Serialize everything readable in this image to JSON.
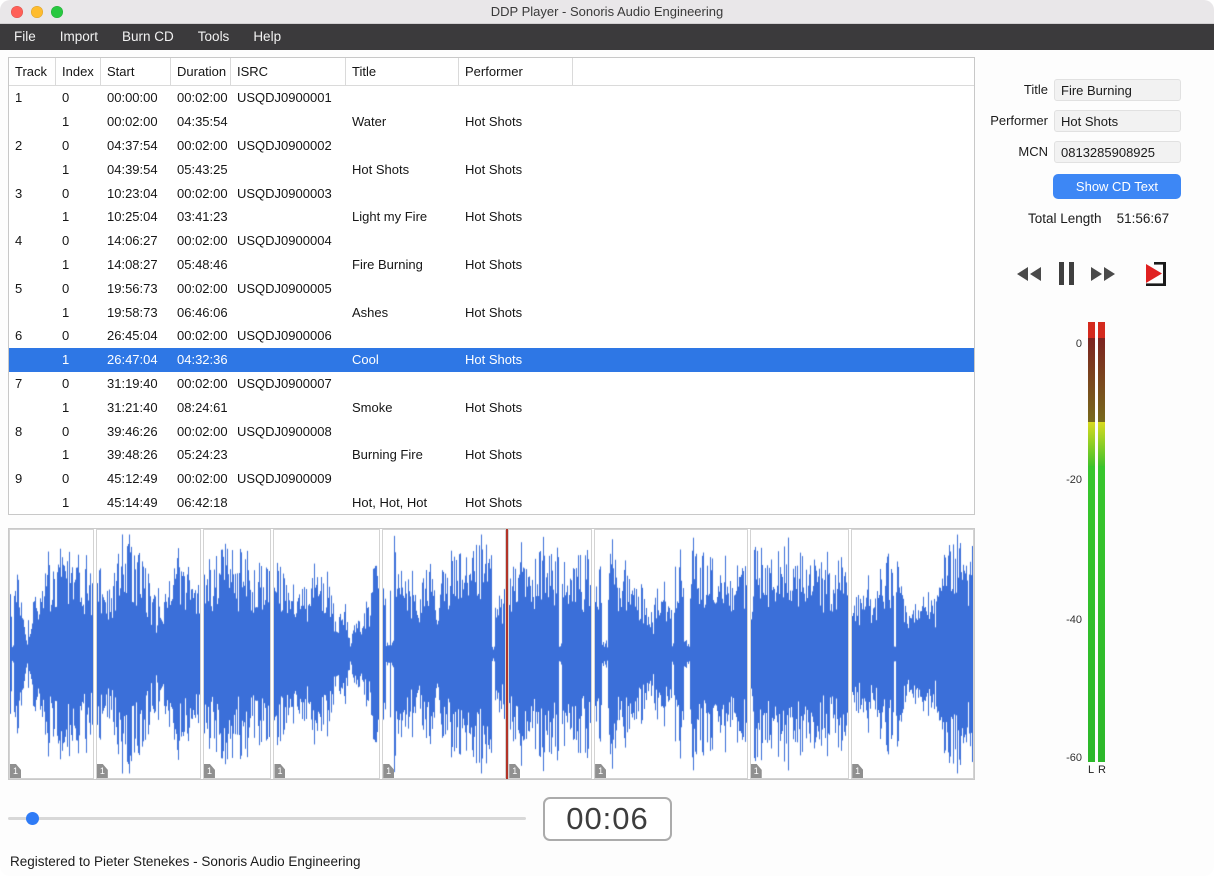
{
  "window": {
    "title": "DDP Player - Sonoris Audio Engineering"
  },
  "menu": {
    "items": [
      {
        "label": "File"
      },
      {
        "label": "Import"
      },
      {
        "label": "Burn CD"
      },
      {
        "label": "Tools"
      },
      {
        "label": "Help"
      }
    ]
  },
  "table": {
    "columns": [
      "Track",
      "Index",
      "Start",
      "Duration",
      "ISRC",
      "Title",
      "Performer"
    ],
    "rows": [
      {
        "track": "1",
        "index": "0",
        "start": "00:00:00",
        "duration": "00:02:00",
        "isrc": "USQDJ0900001",
        "title": "",
        "performer": ""
      },
      {
        "track": "",
        "index": "1",
        "start": "00:02:00",
        "duration": "04:35:54",
        "isrc": "",
        "title": "Water",
        "performer": "Hot Shots"
      },
      {
        "track": "2",
        "index": "0",
        "start": "04:37:54",
        "duration": "00:02:00",
        "isrc": "USQDJ0900002",
        "title": "",
        "performer": ""
      },
      {
        "track": "",
        "index": "1",
        "start": "04:39:54",
        "duration": "05:43:25",
        "isrc": "",
        "title": "Hot Shots",
        "performer": "Hot Shots"
      },
      {
        "track": "3",
        "index": "0",
        "start": "10:23:04",
        "duration": "00:02:00",
        "isrc": "USQDJ0900003",
        "title": "",
        "performer": ""
      },
      {
        "track": "",
        "index": "1",
        "start": "10:25:04",
        "duration": "03:41:23",
        "isrc": "",
        "title": "Light my Fire",
        "performer": "Hot Shots"
      },
      {
        "track": "4",
        "index": "0",
        "start": "14:06:27",
        "duration": "00:02:00",
        "isrc": "USQDJ0900004",
        "title": "",
        "performer": ""
      },
      {
        "track": "",
        "index": "1",
        "start": "14:08:27",
        "duration": "05:48:46",
        "isrc": "",
        "title": "Fire Burning",
        "performer": "Hot Shots"
      },
      {
        "track": "5",
        "index": "0",
        "start": "19:56:73",
        "duration": "00:02:00",
        "isrc": "USQDJ0900005",
        "title": "",
        "performer": ""
      },
      {
        "track": "",
        "index": "1",
        "start": "19:58:73",
        "duration": "06:46:06",
        "isrc": "",
        "title": "Ashes",
        "performer": "Hot Shots"
      },
      {
        "track": "6",
        "index": "0",
        "start": "26:45:04",
        "duration": "00:02:00",
        "isrc": "USQDJ0900006",
        "title": "",
        "performer": ""
      },
      {
        "track": "",
        "index": "1",
        "start": "26:47:04",
        "duration": "04:32:36",
        "isrc": "",
        "title": "Cool",
        "performer": "Hot Shots",
        "selected": true
      },
      {
        "track": "7",
        "index": "0",
        "start": "31:19:40",
        "duration": "00:02:00",
        "isrc": "USQDJ0900007",
        "title": "",
        "performer": ""
      },
      {
        "track": "",
        "index": "1",
        "start": "31:21:40",
        "duration": "08:24:61",
        "isrc": "",
        "title": "Smoke",
        "performer": "Hot Shots"
      },
      {
        "track": "8",
        "index": "0",
        "start": "39:46:26",
        "duration": "00:02:00",
        "isrc": "USQDJ0900008",
        "title": "",
        "performer": ""
      },
      {
        "track": "",
        "index": "1",
        "start": "39:48:26",
        "duration": "05:24:23",
        "isrc": "",
        "title": "Burning Fire",
        "performer": "Hot Shots"
      },
      {
        "track": "9",
        "index": "0",
        "start": "45:12:49",
        "duration": "00:02:00",
        "isrc": "USQDJ0900009",
        "title": "",
        "performer": ""
      },
      {
        "track": "",
        "index": "1",
        "start": "45:14:49",
        "duration": "06:42:18",
        "isrc": "",
        "title": "Hot, Hot, Hot",
        "performer": "Hot Shots"
      }
    ]
  },
  "cd_text": {
    "title_label": "Title",
    "title_value": "Fire Burning",
    "performer_label": "Performer",
    "performer_value": "Hot Shots",
    "mcn_label": "MCN",
    "mcn_value": "0813285908925",
    "show_button": "Show CD Text",
    "total_length_label": "Total Length",
    "total_length_value": "51:56:67"
  },
  "transport": {
    "time_display": "00:06",
    "icons": {
      "rewind": "rewind-icon",
      "pause": "pause-icon",
      "forward": "fast-forward-icon",
      "marker": "play-to-marker-icon"
    }
  },
  "meters": {
    "scale_labels": [
      "0",
      "-20",
      "-40",
      "-60"
    ],
    "channel_labels": [
      "L",
      "R"
    ]
  },
  "waveform": {
    "cursor_segment_index": 5,
    "segments": [
      {
        "marker": "1",
        "weight": 275.7
      },
      {
        "marker": "1",
        "weight": 343.3
      },
      {
        "marker": "1",
        "weight": 221.3
      },
      {
        "marker": "1",
        "weight": 348.6
      },
      {
        "marker": "1",
        "weight": 406.1
      },
      {
        "marker": "1",
        "weight": 272.5
      },
      {
        "marker": "1",
        "weight": 504.8
      },
      {
        "marker": "1",
        "weight": 324.3
      },
      {
        "marker": "1",
        "weight": 402.2
      }
    ]
  },
  "slider": {
    "position_fraction": 0.036
  },
  "status": {
    "text": "Registered to Pieter Stenekes - Sonoris Audio Engineering"
  },
  "colors": {
    "accent": "#2f7bf6",
    "selection": "#2e77e5",
    "waveform": "#3b6fd9",
    "cursor": "#b23428",
    "meter_green": "#38c62d",
    "meter_red": "#d42a1e",
    "button_blue": "#3d87f5"
  }
}
